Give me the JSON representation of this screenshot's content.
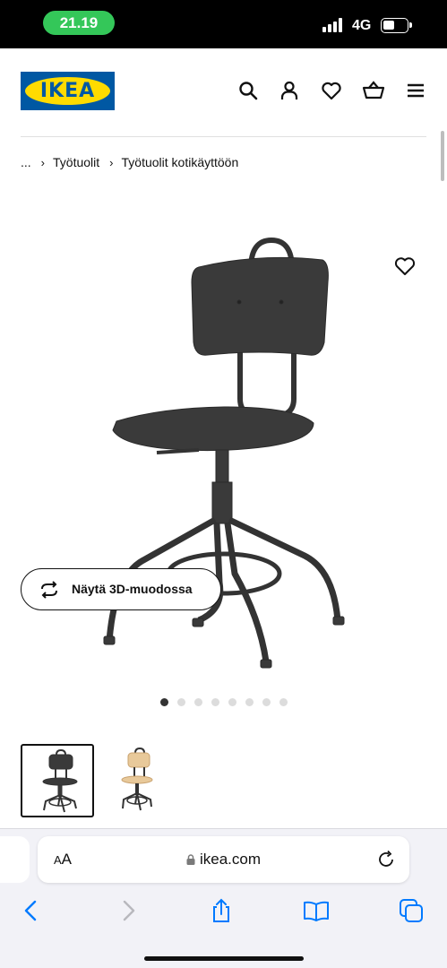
{
  "status_bar": {
    "time": "21.19",
    "network": "4G"
  },
  "brand": {
    "logo_text": "IKEA",
    "blue": "#0058a3",
    "yellow": "#ffdb00"
  },
  "header_icons": [
    "search-icon",
    "account-icon",
    "heart-icon",
    "basket-icon",
    "menu-icon"
  ],
  "breadcrumb": {
    "ellipsis": "...",
    "items": [
      "Työtuolit",
      "Työtuolit kotikäyttöön"
    ]
  },
  "product": {
    "view_3d_label": "Näytä 3D-muodossa",
    "image_count": 8,
    "active_image": 1,
    "thumbnails": [
      {
        "variant": "black",
        "selected": true
      },
      {
        "variant": "birch",
        "selected": false
      }
    ]
  },
  "safari": {
    "aa_small": "A",
    "aa_large": "A",
    "url": "ikea.com",
    "toolbar": [
      "back-icon",
      "forward-icon",
      "share-icon",
      "bookmarks-icon",
      "tabs-icon"
    ]
  },
  "colors": {
    "accent": "#007aff",
    "status_pill": "#34c759"
  }
}
